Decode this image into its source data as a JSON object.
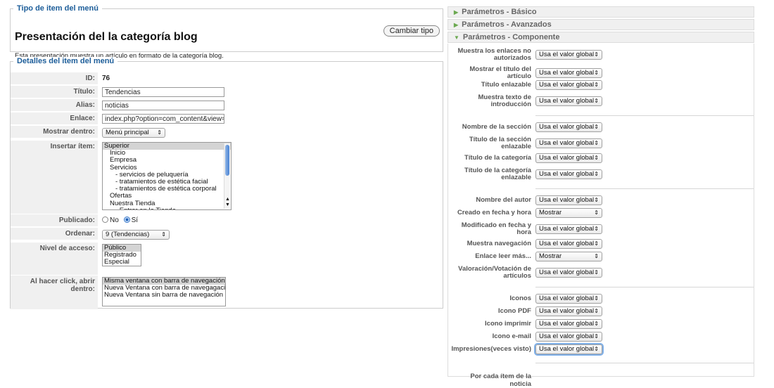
{
  "type_section": {
    "legend": "Tipo de item del menú",
    "change_button": "Cambiar tipo",
    "title": "Presentación del la categoría blog",
    "description": "Esta presentación muestra un artículo en formato de la categoría blog."
  },
  "details": {
    "legend": "Detalles del item del menú",
    "id_label": "ID:",
    "id_value": "76",
    "title_label": "Título:",
    "title_value": "Tendencias",
    "alias_label": "Alias:",
    "alias_value": "noticias",
    "link_label": "Enlace:",
    "link_value": "index.php?option=com_content&view=categ",
    "show_in_label": "Mostrar dentro:",
    "show_in_value": "Menú principal",
    "insert_label": "Insertar ítem:",
    "insert_options": [
      "Superior",
      "Inicio",
      "Empresa",
      "Servicios",
      "- servicios de peluquería",
      "- tratamientos de estética facial",
      "- tratamientos de estética corporal",
      "Ofertas",
      "Nuestra Tienda",
      "- Entrar en la Tienda"
    ],
    "published_label": "Publicado:",
    "published_no": "No",
    "published_yes": "Sí",
    "order_label": "Ordenar:",
    "order_value": "9 (Tendencias)",
    "access_label": "Nivel de acceso:",
    "access_options": [
      "Público",
      "Registrado",
      "Especial"
    ],
    "click_label": "Al hacer click, abrir dentro:",
    "click_options": [
      "Misma ventana con barra de navegación",
      "Nueva Ventana con barra de navegagación",
      "Nueva Ventana sin barra de navegación"
    ]
  },
  "accordion": {
    "basic": "Parámetros - Básico",
    "advanced": "Parámetros - Avanzados",
    "component": "Parámetros - Componente"
  },
  "params": [
    {
      "label": "Muestra los enlaces no autorizados",
      "value": "Usa el valor global"
    },
    {
      "label": "Mostrar el título del artículo",
      "value": "Usa el valor global"
    },
    {
      "label": "Título enlazable",
      "value": "Usa el valor global"
    },
    {
      "label": "Muestra texto de introducción",
      "value": "Usa el valor global"
    },
    {
      "label": "Nombre de la sección",
      "value": "Usa el valor global"
    },
    {
      "label": "Título de la sección enlazable",
      "value": "Usa el valor global"
    },
    {
      "label": "Título de la categoría",
      "value": "Usa el valor global"
    },
    {
      "label": "Título de la categoría enlazable",
      "value": "Usa el valor global"
    },
    {
      "label": "Nombre del autor",
      "value": "Usa el valor global"
    },
    {
      "label": "Creado en fecha y hora",
      "value": "Mostrar"
    },
    {
      "label": "Modificado en fecha y hora",
      "value": "Usa el valor global"
    },
    {
      "label": "Muestra navegación",
      "value": "Usa el valor global"
    },
    {
      "label": "Enlace leer más...",
      "value": "Mostrar"
    },
    {
      "label": "Valoración/Votación de artículos",
      "value": "Usa el valor global"
    },
    {
      "label": "Iconos",
      "value": "Usa el valor global"
    },
    {
      "label": "Icono PDF",
      "value": "Usa el valor global"
    },
    {
      "label": "Icono imprimir",
      "value": "Usa el valor global"
    },
    {
      "label": "Icono e-mail",
      "value": "Usa el valor global"
    },
    {
      "label": "Impresiones(veces visto)",
      "value": "Usa el valor global"
    }
  ],
  "cut_label": "Por cada ítem de la noticia"
}
